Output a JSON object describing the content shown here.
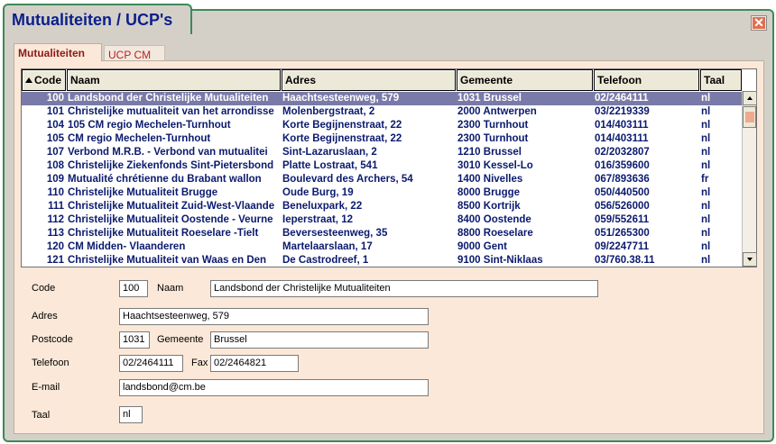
{
  "window": {
    "title": "Mutualiteiten / UCP's",
    "close_glyph": "✕"
  },
  "tabs": [
    {
      "label": "Mutualiteiten"
    },
    {
      "label": "UCP CM"
    }
  ],
  "grid": {
    "columns": [
      "Code",
      "Naam",
      "Adres",
      "Gemeente",
      "Telefoon",
      "Taal"
    ],
    "rows": [
      [
        "100",
        "Landsbond der Christelijke Mutualiteiten",
        "Haachtsesteenweg, 579",
        "1031 Brussel",
        "02/2464111",
        "nl"
      ],
      [
        "101",
        "Christelijke mutualiteit van het arrondisse",
        "Molenbergstraat, 2",
        "2000 Antwerpen",
        "03/2219339",
        "nl"
      ],
      [
        "104",
        "105 CM regio Mechelen-Turnhout",
        "Korte Begijnenstraat, 22",
        "2300 Turnhout",
        "014/403111",
        "nl"
      ],
      [
        "105",
        "CM regio Mechelen-Turnhout",
        "Korte Begijnenstraat, 22",
        "2300 Turnhout",
        "014/403111",
        "nl"
      ],
      [
        "107",
        "Verbond M.R.B. - Verbond van mutualitei",
        "Sint-Lazaruslaan, 2",
        "1210 Brussel",
        "02/2032807",
        "nl"
      ],
      [
        "108",
        "Christelijke Ziekenfonds Sint-Pietersbond",
        "Platte Lostraat, 541",
        "3010 Kessel-Lo",
        "016/359600",
        "nl"
      ],
      [
        "109",
        "Mutualité chrétienne du Brabant wallon",
        "Boulevard des Archers, 54",
        "1400 Nivelles",
        "067/893636",
        "fr"
      ],
      [
        "110",
        "Christelijke Mutualiteit Brugge",
        "Oude Burg, 19",
        "8000 Brugge",
        "050/440500",
        "nl"
      ],
      [
        "111",
        "Christelijke Mutualiteit Zuid-West-Vlaande",
        "Beneluxpark, 22",
        "8500 Kortrijk",
        "056/526000",
        "nl"
      ],
      [
        "112",
        "Christelijke Mutualiteit Oostende - Veurne",
        "Ieperstraat, 12",
        "8400 Oostende",
        "059/552611",
        "nl"
      ],
      [
        "113",
        "Christelijke Mutualiteit Roeselare -Tielt",
        "Beversesteenweg, 35",
        "8800 Roeselare",
        "051/265300",
        "nl"
      ],
      [
        "120",
        "CM Midden- Vlaanderen",
        "Martelaarslaan, 17",
        "9000 Gent",
        "09/2247711",
        "nl"
      ],
      [
        "121",
        "Christelijke Mutualiteit van Waas en Den",
        "De Castrodreef, 1",
        "9100 Sint-Niklaas",
        "03/760.38.11",
        "nl"
      ]
    ]
  },
  "form": {
    "code_label": "Code",
    "code_value": "100",
    "naam_label": "Naam",
    "naam_value": "Landsbond der Christelijke Mutualiteiten",
    "adres_label": "Adres",
    "adres_value": "Haachtsesteenweg, 579",
    "postcode_label": "Postcode",
    "postcode_value": "1031",
    "gemeente_label": "Gemeente",
    "gemeente_value": "Brussel",
    "telefoon_label": "Telefoon",
    "telefoon_value": "02/2464111",
    "fax_label": "Fax",
    "fax_value": "02/2464821",
    "email_label": "E-mail",
    "email_value": "landsbond@cm.be",
    "taal_label": "Taal",
    "taal_value": "nl"
  },
  "colors": {
    "frame": "#3c8a5a",
    "panel": "#fbe8d8",
    "title": "#0b1f8c",
    "selected_row": "#7a7aa8"
  }
}
